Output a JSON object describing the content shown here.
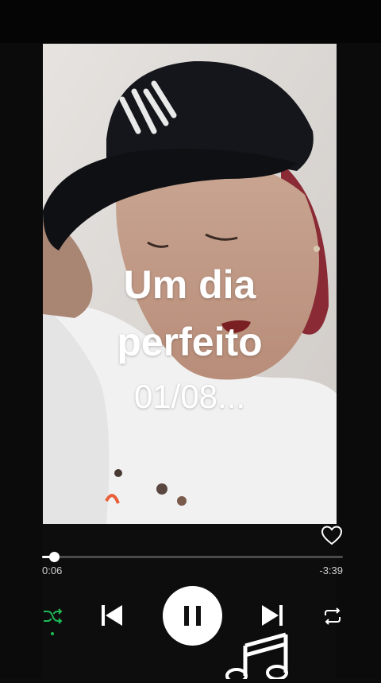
{
  "cover": {
    "title_line1": "Um dia",
    "title_line2": "perfeito",
    "subtitle": "01/08..."
  },
  "player": {
    "elapsed": "0:06",
    "remaining": "-3:39",
    "progress": 0.04
  },
  "icons": {
    "like": "heart-outline-icon",
    "shuffle": "shuffle-icon",
    "previous": "skip-previous-icon",
    "play_pause": "pause-icon",
    "next": "skip-next-icon",
    "repeat": "repeat-icon",
    "note": "music-note-icon"
  },
  "colors": {
    "accent": "#1db954",
    "background": "#0d0d0d"
  }
}
